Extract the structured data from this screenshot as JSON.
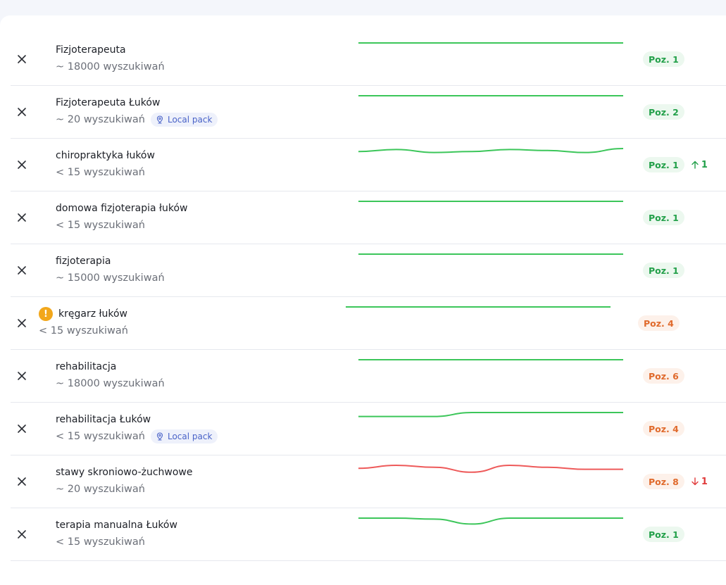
{
  "colors": {
    "line_good": "#3cc65a",
    "line_bad": "#ee5a5a",
    "badge_good_text": "#23a04a",
    "badge_mid_text": "#e06a2c",
    "local_pack": "#4a63c8",
    "warning": "#f2a71b"
  },
  "rows": [
    {
      "keyword": "Fizjoterapeuta",
      "searches": "~ 18000 wyszukiwań",
      "local_pack": "",
      "position": "Poz. 1",
      "delta": "",
      "trend": [
        1,
        1,
        1,
        1,
        1,
        1,
        1,
        1
      ]
    },
    {
      "keyword": "Fizjoterapeuta Łuków",
      "searches": "~ 20 wyszukiwań",
      "local_pack": "Local pack",
      "position": "Poz. 2",
      "delta": "",
      "trend": [
        2,
        2,
        2,
        2,
        2,
        2,
        2,
        2
      ]
    },
    {
      "keyword": "chiropraktyka łuków",
      "searches": "< 15 wyszukiwań",
      "local_pack": "",
      "position": "Poz. 1",
      "delta": "1",
      "trend": [
        1.4,
        1.2,
        1.5,
        1.4,
        1.2,
        1.3,
        1.5,
        1.1
      ]
    },
    {
      "keyword": "domowa fizjoterapia łuków",
      "searches": "< 15 wyszukiwań",
      "local_pack": "",
      "position": "Poz. 1",
      "delta": "",
      "trend": [
        1,
        1,
        1,
        1,
        1,
        1,
        1,
        1
      ]
    },
    {
      "keyword": "fizjoterapia",
      "searches": "~ 15000 wyszukiwań",
      "local_pack": "",
      "position": "Poz. 1",
      "delta": "",
      "trend": [
        1,
        1,
        1,
        1,
        1,
        1,
        1,
        1
      ]
    },
    {
      "keyword": "kręgarz łuków",
      "searches": "< 15 wyszukiwań",
      "local_pack": "",
      "position": "Poz. 4",
      "delta": "",
      "warning": "!",
      "trend": [
        4,
        4,
        4,
        4,
        4,
        4,
        4,
        4
      ]
    },
    {
      "keyword": "rehabilitacja",
      "searches": "~ 18000 wyszukiwań",
      "local_pack": "",
      "position": "Poz. 6",
      "delta": "",
      "trend": [
        6,
        6,
        6,
        6,
        6,
        6,
        6,
        6
      ]
    },
    {
      "keyword": "rehabilitacja Łuków",
      "searches": "< 15 wyszukiwań",
      "local_pack": "Local pack",
      "position": "Poz. 4",
      "delta": "",
      "trend": [
        4.4,
        4.4,
        4.4,
        4,
        4,
        4,
        4,
        4
      ]
    },
    {
      "keyword": "stawy skroniowo-żuchwowe",
      "searches": "~ 20 wyszukiwań",
      "local_pack": "",
      "position": "Poz. 8",
      "delta": "1",
      "trend": [
        7.5,
        7.2,
        7.4,
        7.9,
        7.2,
        7.4,
        7.6,
        7.6
      ]
    },
    {
      "keyword": "terapia manualna Łuków",
      "searches": "< 15 wyszukiwań",
      "local_pack": "",
      "position": "Poz. 1",
      "delta": "",
      "trend": [
        1,
        1,
        1.1,
        1.6,
        1,
        1,
        1,
        1
      ]
    }
  ]
}
